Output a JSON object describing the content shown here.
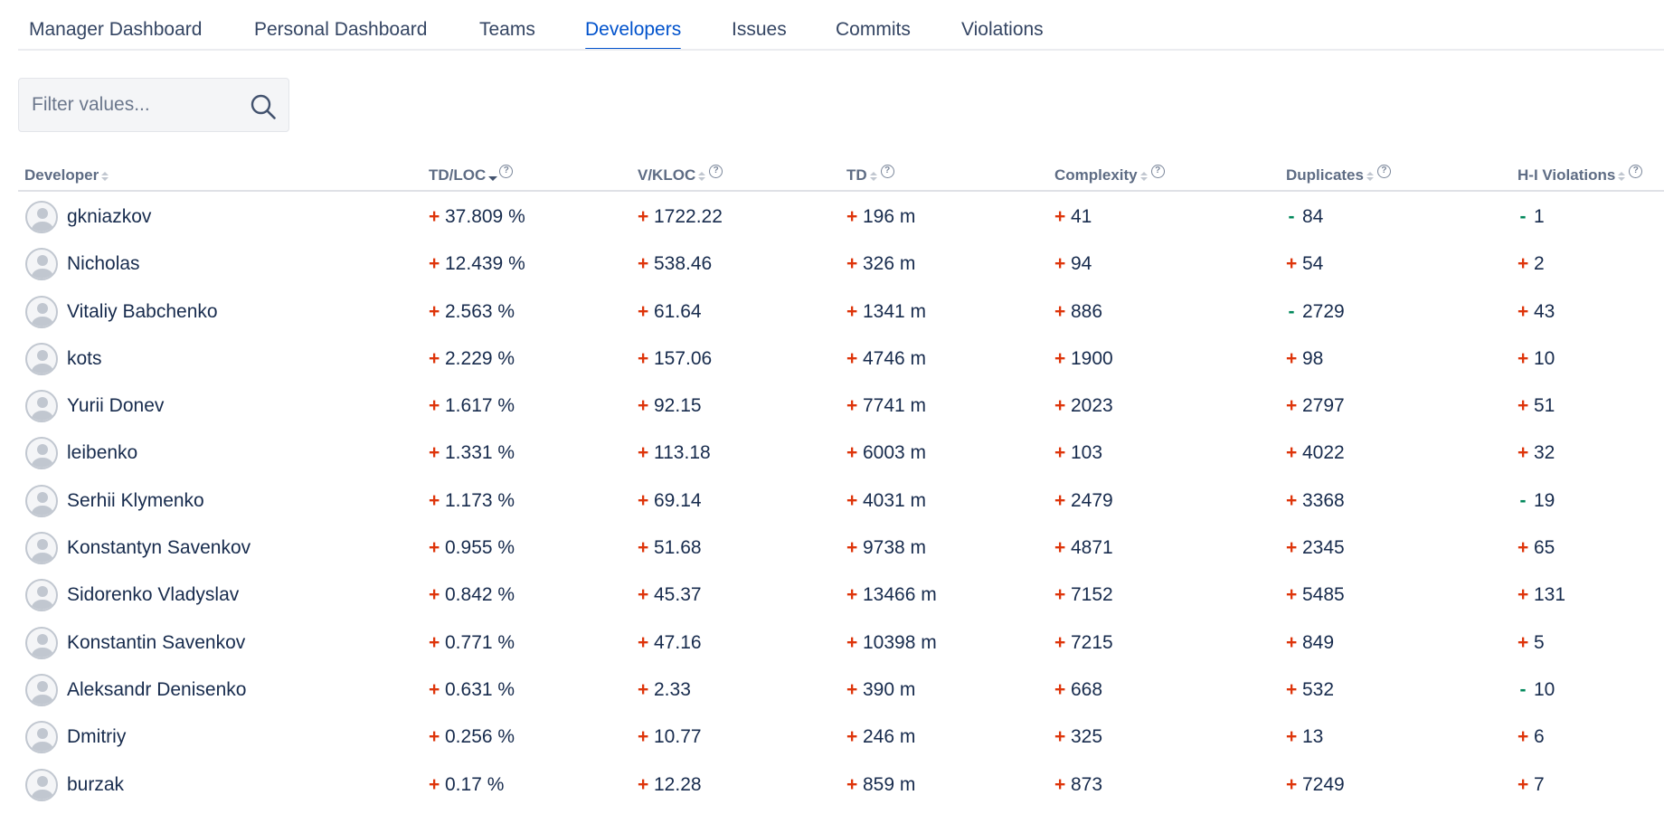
{
  "tabs": [
    {
      "label": "Manager Dashboard",
      "active": false
    },
    {
      "label": "Personal Dashboard",
      "active": false
    },
    {
      "label": "Teams",
      "active": false
    },
    {
      "label": "Developers",
      "active": true
    },
    {
      "label": "Issues",
      "active": false
    },
    {
      "label": "Commits",
      "active": false
    },
    {
      "label": "Violations",
      "active": false
    }
  ],
  "filter": {
    "placeholder": "Filter values...",
    "value": ""
  },
  "table": {
    "columns": [
      {
        "label": "Developer",
        "sort": "none",
        "help": false
      },
      {
        "label": "TD/LOC",
        "sort": "desc",
        "help": true
      },
      {
        "label": "V/KLOC",
        "sort": "none",
        "help": true
      },
      {
        "label": "TD",
        "sort": "none",
        "help": true
      },
      {
        "label": "Complexity",
        "sort": "none",
        "help": true
      },
      {
        "label": "Duplicates",
        "sort": "none",
        "help": true
      },
      {
        "label": "H-I Violations",
        "sort": "none",
        "help": true
      }
    ],
    "sign_symbols": {
      "up": "+",
      "down": "-"
    },
    "rows": [
      {
        "developer": "gkniazkov",
        "td_loc": {
          "value": "37.809 %",
          "trend": "up"
        },
        "v_kloc": {
          "value": "1722.22",
          "trend": "up"
        },
        "td": {
          "value": "196 m",
          "trend": "up"
        },
        "complexity": {
          "value": "41",
          "trend": "up"
        },
        "duplicates": {
          "value": "84",
          "trend": "down"
        },
        "hi_violations": {
          "value": "1",
          "trend": "down"
        }
      },
      {
        "developer": "Nicholas",
        "td_loc": {
          "value": "12.439 %",
          "trend": "up"
        },
        "v_kloc": {
          "value": "538.46",
          "trend": "up"
        },
        "td": {
          "value": "326 m",
          "trend": "up"
        },
        "complexity": {
          "value": "94",
          "trend": "up"
        },
        "duplicates": {
          "value": "54",
          "trend": "up"
        },
        "hi_violations": {
          "value": "2",
          "trend": "up"
        }
      },
      {
        "developer": "Vitaliy Babchenko",
        "td_loc": {
          "value": "2.563 %",
          "trend": "up"
        },
        "v_kloc": {
          "value": "61.64",
          "trend": "up"
        },
        "td": {
          "value": "1341 m",
          "trend": "up"
        },
        "complexity": {
          "value": "886",
          "trend": "up"
        },
        "duplicates": {
          "value": "2729",
          "trend": "down"
        },
        "hi_violations": {
          "value": "43",
          "trend": "up"
        }
      },
      {
        "developer": "kots",
        "td_loc": {
          "value": "2.229 %",
          "trend": "up"
        },
        "v_kloc": {
          "value": "157.06",
          "trend": "up"
        },
        "td": {
          "value": "4746 m",
          "trend": "up"
        },
        "complexity": {
          "value": "1900",
          "trend": "up"
        },
        "duplicates": {
          "value": "98",
          "trend": "up"
        },
        "hi_violations": {
          "value": "10",
          "trend": "up"
        }
      },
      {
        "developer": "Yurii Donev",
        "td_loc": {
          "value": "1.617 %",
          "trend": "up"
        },
        "v_kloc": {
          "value": "92.15",
          "trend": "up"
        },
        "td": {
          "value": "7741 m",
          "trend": "up"
        },
        "complexity": {
          "value": "2023",
          "trend": "up"
        },
        "duplicates": {
          "value": "2797",
          "trend": "up"
        },
        "hi_violations": {
          "value": "51",
          "trend": "up"
        }
      },
      {
        "developer": "leibenko",
        "td_loc": {
          "value": "1.331 %",
          "trend": "up"
        },
        "v_kloc": {
          "value": "113.18",
          "trend": "up"
        },
        "td": {
          "value": "6003 m",
          "trend": "up"
        },
        "complexity": {
          "value": "103",
          "trend": "up"
        },
        "duplicates": {
          "value": "4022",
          "trend": "up"
        },
        "hi_violations": {
          "value": "32",
          "trend": "up"
        }
      },
      {
        "developer": "Serhii Klymenko",
        "td_loc": {
          "value": "1.173 %",
          "trend": "up"
        },
        "v_kloc": {
          "value": "69.14",
          "trend": "up"
        },
        "td": {
          "value": "4031 m",
          "trend": "up"
        },
        "complexity": {
          "value": "2479",
          "trend": "up"
        },
        "duplicates": {
          "value": "3368",
          "trend": "up"
        },
        "hi_violations": {
          "value": "19",
          "trend": "down"
        }
      },
      {
        "developer": "Konstantyn Savenkov",
        "td_loc": {
          "value": "0.955 %",
          "trend": "up"
        },
        "v_kloc": {
          "value": "51.68",
          "trend": "up"
        },
        "td": {
          "value": "9738 m",
          "trend": "up"
        },
        "complexity": {
          "value": "4871",
          "trend": "up"
        },
        "duplicates": {
          "value": "2345",
          "trend": "up"
        },
        "hi_violations": {
          "value": "65",
          "trend": "up"
        }
      },
      {
        "developer": "Sidorenko Vladyslav",
        "td_loc": {
          "value": "0.842 %",
          "trend": "up"
        },
        "v_kloc": {
          "value": "45.37",
          "trend": "up"
        },
        "td": {
          "value": "13466 m",
          "trend": "up"
        },
        "complexity": {
          "value": "7152",
          "trend": "up"
        },
        "duplicates": {
          "value": "5485",
          "trend": "up"
        },
        "hi_violations": {
          "value": "131",
          "trend": "up"
        }
      },
      {
        "developer": "Konstantin Savenkov",
        "td_loc": {
          "value": "0.771 %",
          "trend": "up"
        },
        "v_kloc": {
          "value": "47.16",
          "trend": "up"
        },
        "td": {
          "value": "10398 m",
          "trend": "up"
        },
        "complexity": {
          "value": "7215",
          "trend": "up"
        },
        "duplicates": {
          "value": "849",
          "trend": "up"
        },
        "hi_violations": {
          "value": "5",
          "trend": "up"
        }
      },
      {
        "developer": "Aleksandr Denisenko",
        "td_loc": {
          "value": "0.631 %",
          "trend": "up"
        },
        "v_kloc": {
          "value": "2.33",
          "trend": "up"
        },
        "td": {
          "value": "390 m",
          "trend": "up"
        },
        "complexity": {
          "value": "668",
          "trend": "up"
        },
        "duplicates": {
          "value": "532",
          "trend": "up"
        },
        "hi_violations": {
          "value": "10",
          "trend": "down"
        }
      },
      {
        "developer": "Dmitriy",
        "td_loc": {
          "value": "0.256 %",
          "trend": "up"
        },
        "v_kloc": {
          "value": "10.77",
          "trend": "up"
        },
        "td": {
          "value": "246 m",
          "trend": "up"
        },
        "complexity": {
          "value": "325",
          "trend": "up"
        },
        "duplicates": {
          "value": "13",
          "trend": "up"
        },
        "hi_violations": {
          "value": "6",
          "trend": "up"
        }
      },
      {
        "developer": "burzak",
        "td_loc": {
          "value": "0.17 %",
          "trend": "up"
        },
        "v_kloc": {
          "value": "12.28",
          "trend": "up"
        },
        "td": {
          "value": "859 m",
          "trend": "up"
        },
        "complexity": {
          "value": "873",
          "trend": "up"
        },
        "duplicates": {
          "value": "7249",
          "trend": "up"
        },
        "hi_violations": {
          "value": "7",
          "trend": "up"
        }
      }
    ]
  },
  "colors": {
    "accent": "#0052cc",
    "trend_up": "#de350b",
    "trend_down": "#00875a"
  }
}
